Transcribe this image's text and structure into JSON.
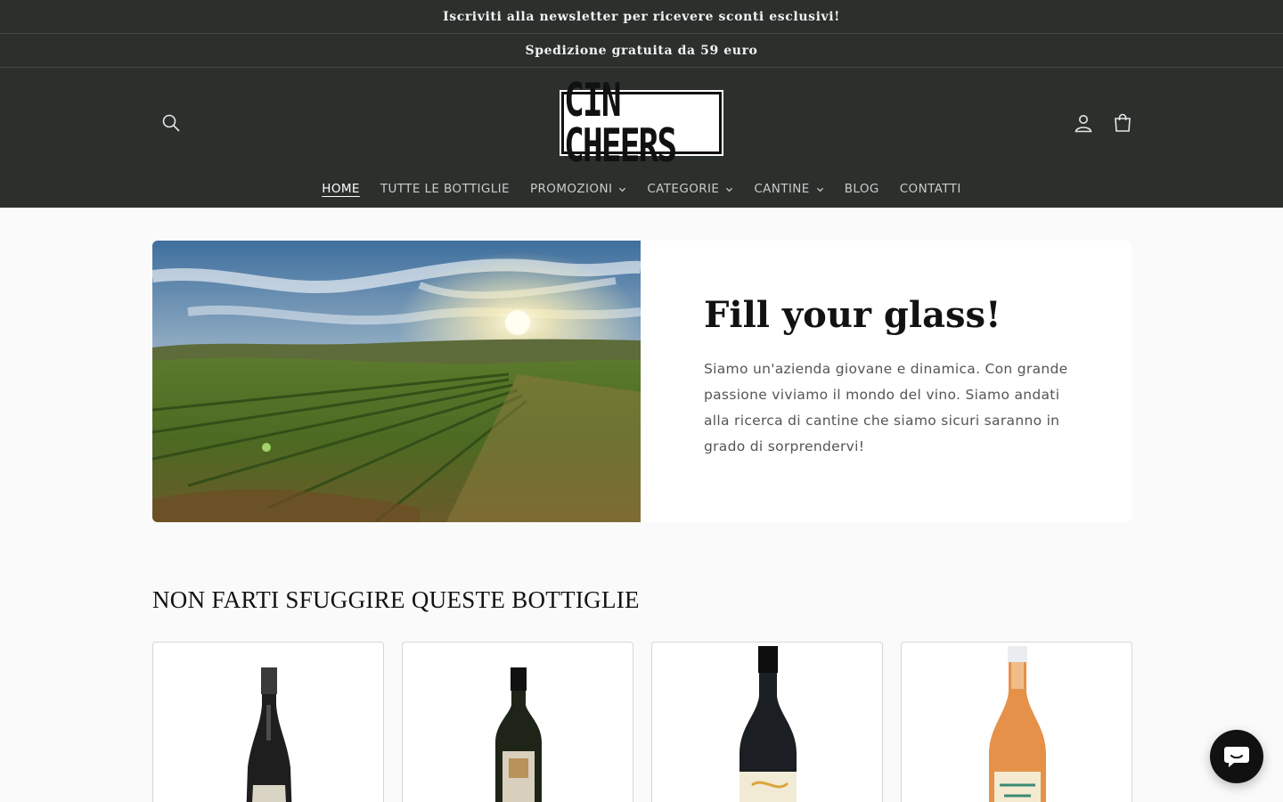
{
  "announcements": [
    "Iscriviti alla newsletter per ricevere sconti esclusivi!",
    "Spedizione gratuita da 59 euro"
  ],
  "header": {
    "logo_text": "CIN CHEERS",
    "search_icon": "search-icon",
    "account_icon": "account-icon",
    "cart_icon": "cart-icon"
  },
  "nav": {
    "items": [
      {
        "label": "HOME",
        "active": true,
        "dropdown": false
      },
      {
        "label": "TUTTE LE BOTTIGLIE",
        "active": false,
        "dropdown": false
      },
      {
        "label": "PROMOZIONI",
        "active": false,
        "dropdown": true
      },
      {
        "label": "CATEGORIE",
        "active": false,
        "dropdown": true
      },
      {
        "label": "CANTINE",
        "active": false,
        "dropdown": true
      },
      {
        "label": "BLOG",
        "active": false,
        "dropdown": false
      },
      {
        "label": "CONTATTI",
        "active": false,
        "dropdown": false
      }
    ]
  },
  "hero": {
    "title": "Fill your glass!",
    "body": "Siamo un'azienda giovane e dinamica. Con grande passione viviamo il mondo del vino. Siamo andati alla ricerca di cantine che siamo sicuri saranno in grado di sorprendervi!"
  },
  "featured": {
    "title": "NON FARTI SFUGGIRE QUESTE BOTTIGLIE"
  },
  "colors": {
    "header_bg": "#2c302d",
    "page_bg": "#fafafa"
  }
}
